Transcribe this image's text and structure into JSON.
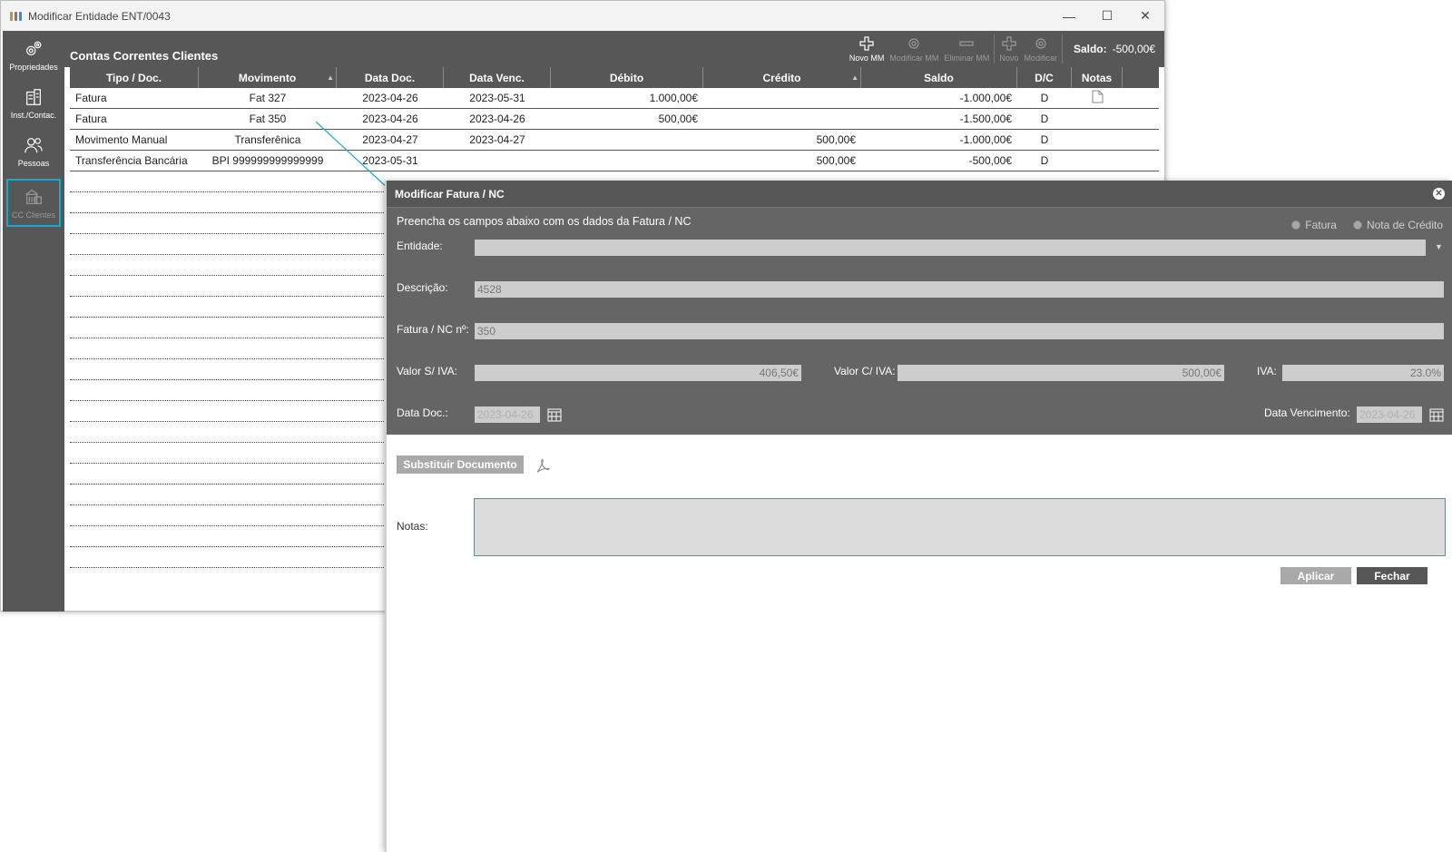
{
  "window": {
    "title": "Modificar Entidade ENT/0043",
    "controls": [
      "—",
      "☐",
      "✕"
    ]
  },
  "sidebar": {
    "items": [
      {
        "label": "Propriedades",
        "icon": "gears-icon"
      },
      {
        "label": "Inst./Contac.",
        "icon": "building-icon"
      },
      {
        "label": "Pessoas",
        "icon": "people-icon"
      },
      {
        "label": "CC Clientes",
        "icon": "bank-icon",
        "active": true
      }
    ]
  },
  "content": {
    "title": "Contas Correntes Clientes",
    "toolbar": [
      {
        "label": "Novo MM",
        "icon": "plus-icon",
        "enabled": true
      },
      {
        "label": "Modificar MM",
        "icon": "gear-icon",
        "enabled": false
      },
      {
        "label": "Eliminar MM",
        "icon": "minus-icon",
        "enabled": false
      },
      {
        "label": "Novo",
        "icon": "plus-icon",
        "enabled": false
      },
      {
        "label": "Modificar",
        "icon": "gear-icon",
        "enabled": false
      }
    ],
    "saldo_label": "Saldo:",
    "saldo_value": "-500,00€"
  },
  "table": {
    "columns": [
      "Tipo / Doc.",
      "Movimento",
      "Data Doc.",
      "Data Venc.",
      "Débito",
      "Crédito",
      "Saldo",
      "D/C",
      "Notas"
    ],
    "rows": [
      [
        "Fatura",
        "Fat 327",
        "2023-04-26",
        "2023-05-31",
        "1.000,00€",
        "",
        "-1.000,00€",
        "D",
        "note"
      ],
      [
        "Fatura",
        "Fat 350",
        "2023-04-26",
        "2023-04-26",
        "500,00€",
        "",
        "-1.500,00€",
        "D",
        ""
      ],
      [
        "Movimento Manual",
        "Transferênica",
        "2023-04-27",
        "2023-04-27",
        "",
        "500,00€",
        "-1.000,00€",
        "D",
        ""
      ],
      [
        "Transferência Bancária",
        "BPI 999999999999999",
        "2023-05-31",
        "",
        "",
        "500,00€",
        "-500,00€",
        "D",
        ""
      ]
    ]
  },
  "dialog": {
    "title": "Modificar Fatura / NC",
    "subtitle": "Preencha os campos abaixo com os dados da Fatura / NC",
    "radio_fatura": "Fatura",
    "radio_nc": "Nota de Crédito",
    "entidade_label": "Entidade:",
    "entidade_value": "",
    "descricao_label": "Descrição:",
    "descricao_value": "4528",
    "fatura_nc_label": "Fatura / NC nº:",
    "fatura_nc_value": "350",
    "valor_s_iva_label": "Valor S/ IVA:",
    "valor_s_iva_value": "406,50€",
    "valor_c_iva_label": "Valor C/ IVA:",
    "valor_c_iva_value": "500,00€",
    "iva_label": "IVA:",
    "iva_value": "23.0%",
    "data_doc_label": "Data Doc.:",
    "data_doc_value": "2023-04-26",
    "data_venc_label": "Data Vencimento:",
    "data_venc_value": "2023-04-26",
    "substituir_label": "Substituir Documento",
    "notas_label": "Notas:",
    "aplicar_label": "Aplicar",
    "fechar_label": "Fechar"
  },
  "colors": {
    "panel_dark": "#575757",
    "form_bg": "#656565",
    "field_bg": "#cdcdcd",
    "accent": "#19a9c7"
  }
}
